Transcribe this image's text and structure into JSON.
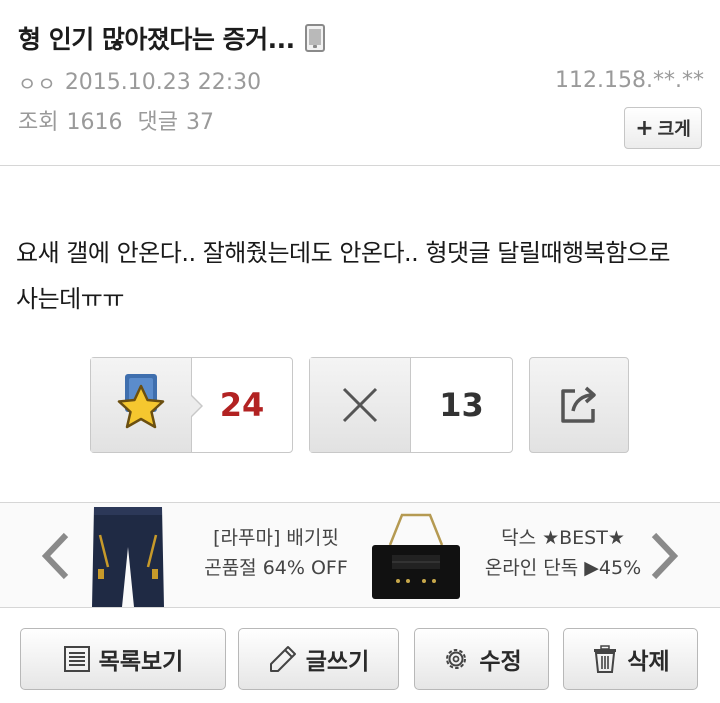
{
  "post": {
    "title": "형 인기 많아졌다는 증거...",
    "title_icon": "mobile-phone-icon",
    "author_icon": "ㅇㅇ",
    "date": "2015.10.23 22:30",
    "ip": "112.158.**.**",
    "views_label": "조회",
    "views": "1616",
    "comments_label": "댓글",
    "comments": "37",
    "enlarge_label": "크게",
    "body_line1": "요새 갤에 안온다.. 잘해줬는데도 안온다.. 형댓글 달릴때행복함으로",
    "body_line2": "사는데ㅠㅠ"
  },
  "votes": {
    "like_icon": "star-icon",
    "like_count": "24",
    "like_color": "#b22222",
    "dislike_icon": "x-icon",
    "dislike_count": "13",
    "share_icon": "share-icon"
  },
  "ads": {
    "item1_line1": "[라푸마] 배기핏",
    "item1_line2": "곤품절 64% OFF",
    "item2_line1": "닥스 ★BEST★",
    "item2_line2": "온라인 단독 ▶45%"
  },
  "actions": {
    "list_label": "목록보기",
    "write_label": "글쓰기",
    "edit_label": "수정",
    "delete_label": "삭제"
  }
}
